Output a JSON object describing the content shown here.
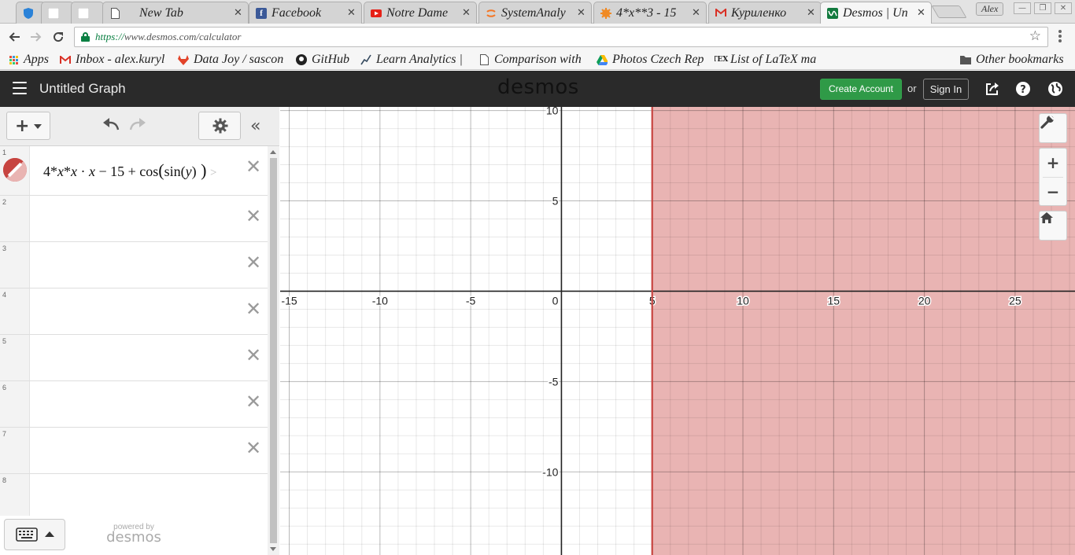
{
  "browser": {
    "tabs": [
      {
        "title": "",
        "icon": "shield-icon"
      },
      {
        "title": "",
        "icon": "blank-page-icon"
      },
      {
        "title": "",
        "icon": "blank-page-icon"
      },
      {
        "title": "New Tab",
        "icon": "page-icon"
      },
      {
        "title": "Facebook",
        "icon": "facebook-icon"
      },
      {
        "title": "Notre Dame",
        "icon": "youtube-icon"
      },
      {
        "title": "SystemAnaly",
        "icon": "jupyter-icon"
      },
      {
        "title": "4*x**3 - 15",
        "icon": "wolfram-icon"
      },
      {
        "title": "Куриленко",
        "icon": "gmail-icon"
      },
      {
        "title": "Desmos | Un",
        "icon": "desmos-icon"
      }
    ],
    "profile_name": "Alex",
    "url_scheme": "https://",
    "url_rest": "www.desmos.com/calculator",
    "bookmarks": [
      {
        "label": "Apps",
        "icon": "apps-grid-icon"
      },
      {
        "label": "Inbox - alex.kuryl",
        "icon": "gmail-icon"
      },
      {
        "label": "Data Joy / sascon",
        "icon": "gitlab-icon"
      },
      {
        "label": "GitHub",
        "icon": "github-icon"
      },
      {
        "label": "Learn Analytics |",
        "icon": "chart-line-icon"
      },
      {
        "label": "Comparison with",
        "icon": "page-icon"
      },
      {
        "label": "Photos Czech Rep",
        "icon": "drive-icon"
      },
      {
        "label": "List of LaTeX ma",
        "icon": "tex-icon"
      },
      {
        "label": "Other bookmarks",
        "icon": "folder-icon"
      }
    ]
  },
  "desmos": {
    "graph_title": "Untitled Graph",
    "brand": "desmos",
    "create_account": "Create Account",
    "or": "or",
    "sign_in": "Sign In",
    "expressions": [
      {
        "number": "1",
        "latex_parts": [
          "4*",
          "x",
          "*",
          "x",
          " · ",
          "x",
          " − 15 + cos",
          "(",
          "sin",
          "(",
          "y",
          ")",
          " )"
        ],
        "color": "#c74440"
      },
      {
        "number": "2"
      },
      {
        "number": "3"
      },
      {
        "number": "4"
      },
      {
        "number": "5"
      },
      {
        "number": "6"
      },
      {
        "number": "7"
      },
      {
        "number": "8"
      }
    ],
    "powered_by": "powered by",
    "powered_brand": "desmos"
  },
  "chart_data": {
    "type": "scatter",
    "x_ticks": [
      -15,
      -10,
      -5,
      0,
      5,
      10,
      15,
      20,
      25
    ],
    "y_ticks": [
      10,
      5,
      -5,
      -10
    ],
    "xlim": [
      -15.5,
      28.3
    ],
    "ylim": [
      -14.6,
      10.2
    ],
    "grid": true,
    "region": {
      "inequality": "x ≥ 5",
      "boundary_x": 5,
      "fill_color": "#c74440"
    }
  }
}
